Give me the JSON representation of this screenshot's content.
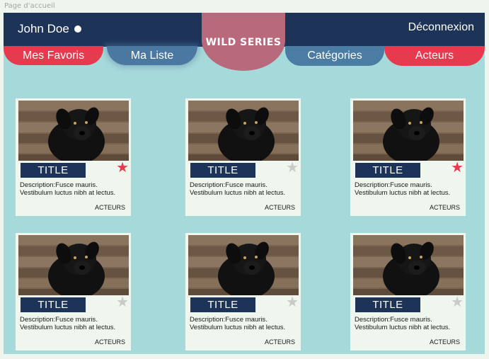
{
  "page_label": "Page d'accueil",
  "header": {
    "user_name": "John Doe",
    "logout_label": "Déconnexion",
    "logo_text": "WILD SERIES"
  },
  "nav": {
    "favorites": "Mes Favoris",
    "my_list": "Ma Liste",
    "categories": "Catégories",
    "actors": "Acteurs"
  },
  "cards": [
    {
      "title": "TITLE",
      "description": "Description:Fusce mauris. Vestibulum luctus nibh at lectus.",
      "actors_label": "ACTEURS",
      "favorite": true
    },
    {
      "title": "TITLE",
      "description": "Description:Fusce mauris. Vestibulum luctus nibh at lectus.",
      "actors_label": "ACTEURS",
      "favorite": false
    },
    {
      "title": "TITLE",
      "description": "Description:Fusce mauris. Vestibulum luctus nibh at lectus.",
      "actors_label": "ACTEURS",
      "favorite": true
    },
    {
      "title": "TITLE",
      "description": "Description:Fusce mauris. Vestibulum luctus nibh at lectus.",
      "actors_label": "ACTEURS",
      "favorite": false
    },
    {
      "title": "TITLE",
      "description": "Description:Fusce mauris. Vestibulum luctus nibh at lectus.",
      "actors_label": "ACTEURS",
      "favorite": false
    },
    {
      "title": "TITLE",
      "description": "Description:Fusce mauris. Vestibulum luctus nibh at lectus.",
      "actors_label": "ACTEURS",
      "favorite": false
    }
  ],
  "icons": {
    "star": "star-icon",
    "status_dot": "online-dot-icon"
  },
  "colors": {
    "header": "#1d3358",
    "accent_red": "#e63b4e",
    "accent_blue": "#4a7ca4",
    "background": "#a6d9da",
    "logo_blob": "#b86a7c"
  }
}
